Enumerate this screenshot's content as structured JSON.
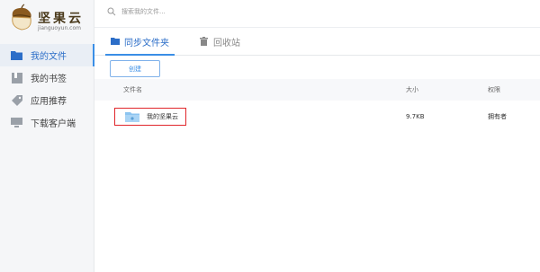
{
  "app": {
    "name": "坚果云",
    "domain": "jianguoyun.com"
  },
  "sidebar": {
    "items": [
      {
        "label": "我的文件",
        "icon": "folder-icon",
        "active": true
      },
      {
        "label": "我的书签",
        "icon": "bookmark-icon",
        "active": false
      },
      {
        "label": "应用推荐",
        "icon": "tag-icon",
        "active": false
      },
      {
        "label": "下载客户端",
        "icon": "monitor-icon",
        "active": false
      }
    ]
  },
  "search": {
    "placeholder": "搜索我的文件..."
  },
  "tabs": [
    {
      "label": "同步文件夹",
      "icon": "folder-icon",
      "active": true
    },
    {
      "label": "回收站",
      "icon": "trash-icon",
      "active": false
    }
  ],
  "toolbar": {
    "create_label": "创建"
  },
  "table": {
    "columns": {
      "name": "文件名",
      "size": "大小",
      "permission": "权限"
    },
    "rows": [
      {
        "name": "我的坚果云",
        "size": "9.7KB",
        "permission": "拥有者",
        "icon": "folder-icon"
      }
    ]
  },
  "colors": {
    "accent": "#3a8ee6",
    "highlight": "#e0262b",
    "sidebar_bg": "#f5f6f8"
  }
}
